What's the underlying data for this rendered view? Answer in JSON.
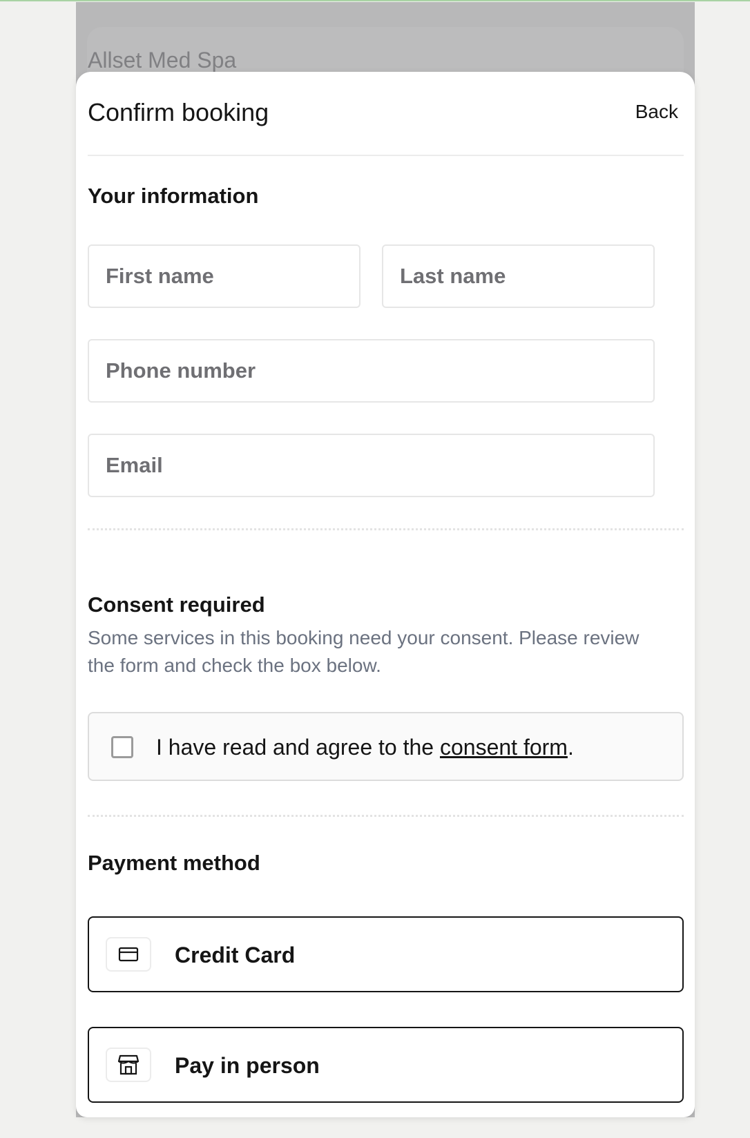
{
  "backdrop": {
    "business_name": "Allset Med Spa"
  },
  "header": {
    "title": "Confirm booking",
    "back_label": "Back"
  },
  "your_information": {
    "heading": "Your information",
    "first_name_placeholder": "First name",
    "last_name_placeholder": "Last name",
    "phone_placeholder": "Phone number",
    "email_placeholder": "Email"
  },
  "consent": {
    "heading": "Consent required",
    "description": "Some services in this booking need your consent. Please review the form and check the box below.",
    "checkbox_prefix": "I have read and agree to the ",
    "link_text": "consent form",
    "checkbox_suffix": ".",
    "checked": false
  },
  "payment": {
    "heading": "Payment method",
    "options": [
      {
        "label": "Credit Card",
        "icon": "credit-card-icon"
      },
      {
        "label": "Pay in person",
        "icon": "store-icon"
      }
    ]
  },
  "colors": {
    "accent_line": "#a9d3a4",
    "border_dark": "#151515",
    "muted_text": "#6b7280"
  }
}
